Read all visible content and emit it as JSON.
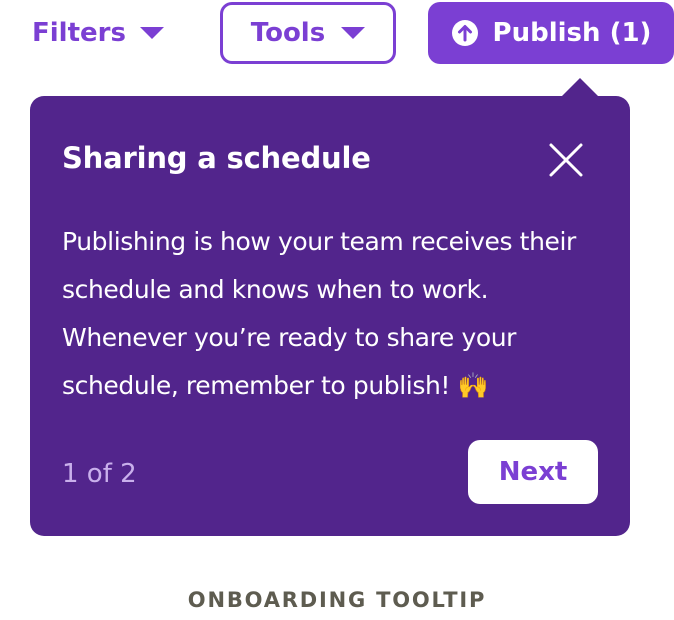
{
  "toolbar": {
    "filters_label": "Filters",
    "tools_label": "Tools",
    "publish_label": "Publish (1)",
    "filters_icon": "caret-down-icon",
    "tools_icon": "caret-down-icon",
    "publish_icon": "arrow-up-circle-icon"
  },
  "tooltip": {
    "title": "Sharing a schedule",
    "body": "Publishing is how your team receives their schedule and knows when to work. Whenever you’re ready to share your schedule, remember to publish! 🙌",
    "step_counter": "1 of 2",
    "next_label": "Next",
    "close_icon": "close-icon"
  },
  "caption": "ONBOARDING TOOLTIP",
  "colors": {
    "accent": "#7b3fd3",
    "tooltip_bg": "#52258c",
    "counter_text": "#c9b0ec",
    "caption_text": "#5e5c50"
  }
}
